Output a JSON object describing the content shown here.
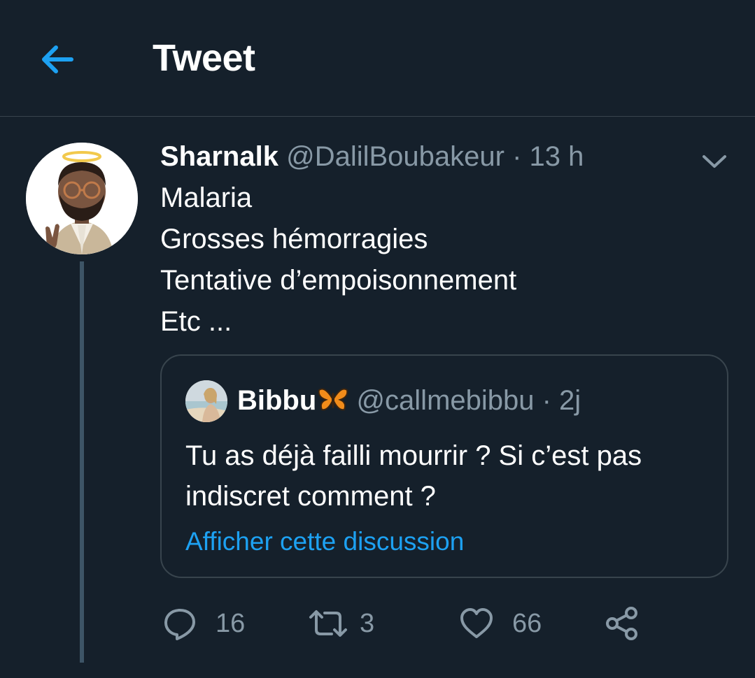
{
  "header": {
    "title": "Tweet",
    "back_icon": "arrow-left-icon",
    "accent_color": "#1da1f2"
  },
  "tweet": {
    "display_name": "Sharnalk",
    "handle": "@DalilBoubakeur",
    "time": "· 13 h",
    "body_lines": [
      "Malaria",
      "Grosses hémorragies",
      "Tentative d’empoisonnement",
      "Etc ..."
    ],
    "menu_icon": "chevron-down-icon"
  },
  "quoted_tweet": {
    "display_name": "Bibbu",
    "emoji_icon": "butterfly-emoji-icon",
    "handle": "@callmebibbu",
    "time": "· 2j",
    "text": "Tu as déjà failli mourrir ? Si c’est pas indiscret comment ?",
    "link_text": "Afficher cette discussion"
  },
  "actions": {
    "replies": "16",
    "retweets": "3",
    "likes": "66",
    "reply_icon": "reply-icon",
    "retweet_icon": "retweet-icon",
    "like_icon": "heart-icon",
    "share_icon": "share-icon"
  },
  "colors": {
    "background": "#15202b",
    "border": "#38444d",
    "muted_text": "#8899a6",
    "thread_line": "#3d5466"
  }
}
